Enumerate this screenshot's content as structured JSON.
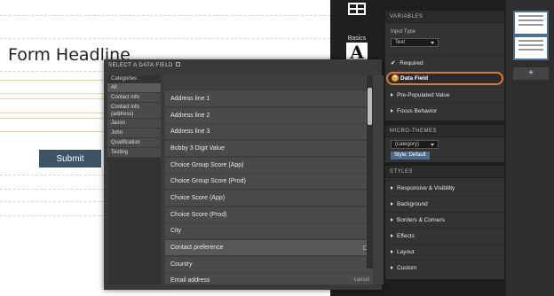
{
  "canvas": {
    "headline": "Form Headline",
    "submit_label": "Submit"
  },
  "tools": {
    "basics_label": "Basics",
    "text_tool_glyph": "A",
    "icons": [
      "grid-layout-icon",
      "text-a-icon"
    ]
  },
  "panel": {
    "variables_header": "VARIABLES",
    "input_type_label": "Input Type",
    "input_type_value": "Text",
    "required_label": "Required",
    "data_field_label": "Data Field",
    "prepopulated_label": "Pre-Populated Value",
    "focus_label": "Focus Behavior",
    "micro_header": "MICRO-THEMES",
    "category_value": "(category)",
    "style_chip": "Style: Default",
    "styles_header": "STYLES",
    "style_items": [
      "Responsive & Visibility",
      "Background",
      "Borders & Corners",
      "Effects",
      "Layout",
      "Custom"
    ]
  },
  "thumbs": {
    "add_label": "+"
  },
  "modal": {
    "title": "SELECT A DATA FIELD",
    "categories_header": "Categories",
    "categories": [
      "All",
      "Contact info",
      "Contact info (address)",
      "Jason",
      "John",
      "Qualification",
      "Testing"
    ],
    "selected_category": "All",
    "fields": [
      "Address line 1",
      "Address line 2",
      "Address line 3",
      "Bobby 3 Digit Value",
      "Choice Group Score (App)",
      "Choice Group Score (Prod)",
      "Choice Score (App)",
      "Choice Score (Prod)",
      "City",
      "Contact preference",
      "Country",
      "Email address"
    ],
    "highlighted_field": "Contact preference",
    "cancel_label": "cancel"
  },
  "colors": {
    "accent_orange": "#e37720",
    "submit_bg": "#3d5467",
    "chip_blue": "#4d6b8a"
  }
}
